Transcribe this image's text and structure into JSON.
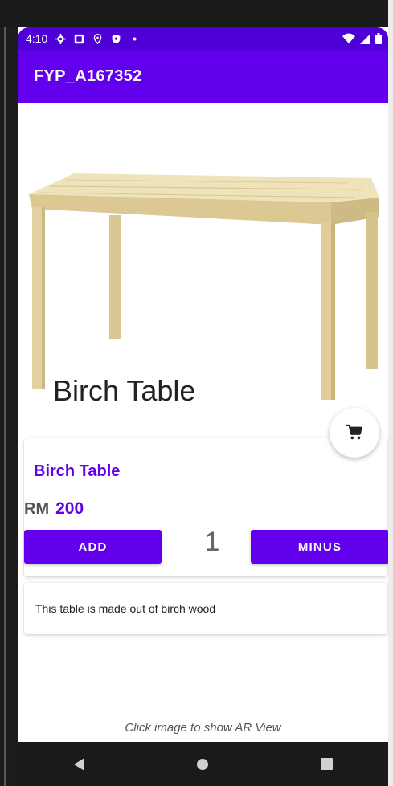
{
  "statusbar": {
    "time": "4:10",
    "icons": [
      "settings-icon",
      "image-icon",
      "location-icon",
      "shield-icon",
      "dot-icon"
    ],
    "right_icons": [
      "wifi-icon",
      "signal-icon",
      "battery-icon"
    ]
  },
  "appbar": {
    "title": "FYP_A167352"
  },
  "hero": {
    "title": "Birch Table"
  },
  "product": {
    "name": "Birch Table",
    "currency": "RM",
    "price": "200",
    "quantity": "1",
    "add_label": "ADD",
    "minus_label": "MINUS",
    "description": "This table is made out of birch wood"
  },
  "hint": "Click image to show AR View",
  "colors": {
    "primary": "#6200ee",
    "status_bar": "#4e00d6",
    "wood": "#e3d3a2"
  },
  "navbar": {
    "icons": [
      "back-icon",
      "home-icon",
      "recents-icon"
    ]
  }
}
